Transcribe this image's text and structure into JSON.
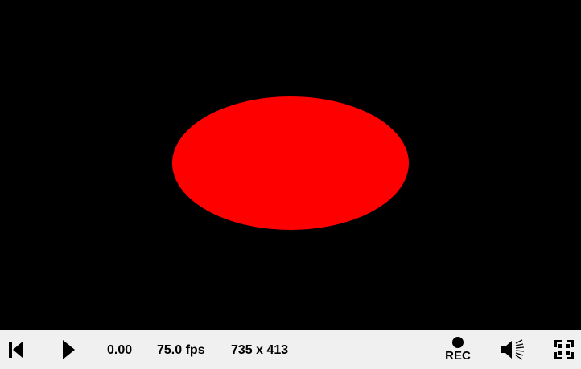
{
  "canvas": {
    "background": "#000000",
    "shape": "ellipse",
    "shape_color": "#ff0000"
  },
  "controls": {
    "background": "#f0f0f0",
    "time": "0.00",
    "fps": "75.0 fps",
    "resolution": "735 x 413",
    "rec_label": "REC",
    "icons": {
      "rewind": "skip-to-start-icon",
      "play": "play-icon",
      "record": "record-icon",
      "volume": "volume-icon",
      "fullscreen": "fullscreen-icon"
    }
  }
}
